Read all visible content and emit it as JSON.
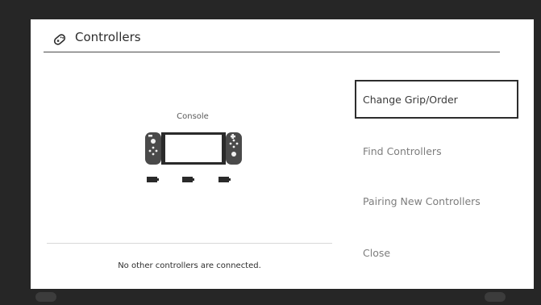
{
  "dialog": {
    "title": "Controllers",
    "title_icon": "controller-icon"
  },
  "console": {
    "label": "Console",
    "icon": "switch-console-icon",
    "battery_icons": [
      "battery-icon",
      "battery-icon",
      "battery-icon"
    ]
  },
  "status": {
    "message": "No other controllers are connected."
  },
  "menu": {
    "items": [
      {
        "label": "Change Grip/Order",
        "selected": true
      },
      {
        "label": "Find Controllers",
        "selected": false
      },
      {
        "label": "Pairing New Controllers",
        "selected": false
      },
      {
        "label": "Close",
        "selected": false
      }
    ]
  },
  "colors": {
    "dialog_bg": "#ffffff",
    "backdrop": "#262626",
    "selection_border": "#2d2d2d",
    "menu_text": "#7d7d7d"
  }
}
